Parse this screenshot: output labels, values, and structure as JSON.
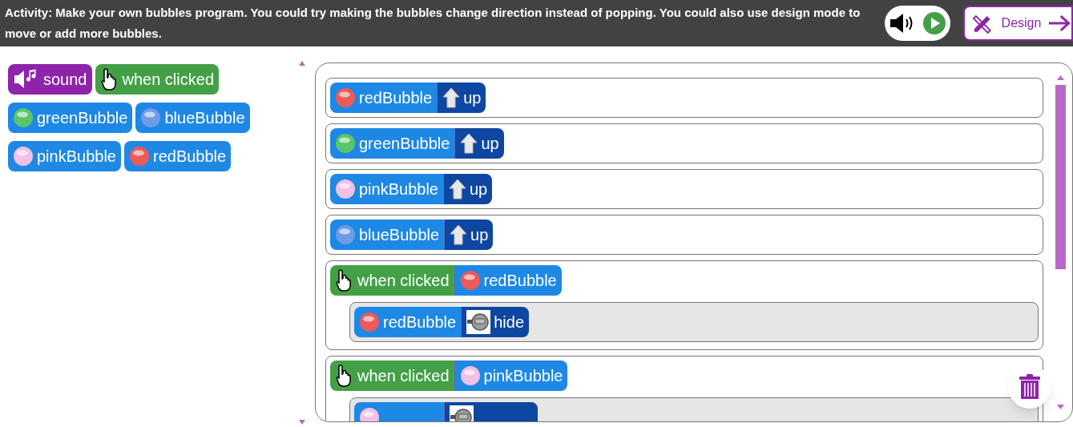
{
  "activity": {
    "text": "Activity: Make your own bubbles program. You could try making the bubbles change direction instead of popping. You could also use design mode to move or add more bubbles."
  },
  "design_button": {
    "label": "Design"
  },
  "palette": [
    {
      "kind": "sound",
      "label": "sound"
    },
    {
      "kind": "event",
      "label": "when clicked"
    },
    {
      "kind": "sprite",
      "label": "greenBubble",
      "color": "#5cc46a"
    },
    {
      "kind": "sprite",
      "label": "blueBubble",
      "color": "#6f9be6"
    },
    {
      "kind": "sprite",
      "label": "pinkBubble",
      "color": "#f2c0e4"
    },
    {
      "kind": "sprite",
      "label": "redBubble",
      "color": "#ec5a5a"
    }
  ],
  "script": [
    {
      "blocks": [
        {
          "kind": "sprite",
          "label": "redBubble",
          "color": "#ec5a5a"
        },
        {
          "kind": "move",
          "label": "up"
        }
      ]
    },
    {
      "blocks": [
        {
          "kind": "sprite",
          "label": "greenBubble",
          "color": "#5cc46a"
        },
        {
          "kind": "move",
          "label": "up"
        }
      ]
    },
    {
      "blocks": [
        {
          "kind": "sprite",
          "label": "pinkBubble",
          "color": "#f2c0e4"
        },
        {
          "kind": "move",
          "label": "up"
        }
      ]
    },
    {
      "blocks": [
        {
          "kind": "sprite",
          "label": "blueBubble",
          "color": "#6f9be6"
        },
        {
          "kind": "move",
          "label": "up"
        }
      ]
    },
    {
      "blocks": [
        {
          "kind": "event",
          "label": "when clicked"
        },
        {
          "kind": "sprite",
          "label": "redBubble",
          "color": "#ec5a5a"
        }
      ],
      "children": [
        {
          "blocks": [
            {
              "kind": "sprite",
              "label": "redBubble",
              "color": "#ec5a5a"
            },
            {
              "kind": "hide",
              "label": "hide"
            }
          ]
        }
      ]
    },
    {
      "blocks": [
        {
          "kind": "event",
          "label": "when clicked"
        },
        {
          "kind": "sprite",
          "label": "pinkBubble",
          "color": "#f2c0e4"
        }
      ],
      "children": [
        {
          "blocks": [
            {
              "kind": "sprite",
              "color": "#f2c0e4"
            },
            {
              "kind": "hide"
            }
          ]
        }
      ]
    }
  ]
}
